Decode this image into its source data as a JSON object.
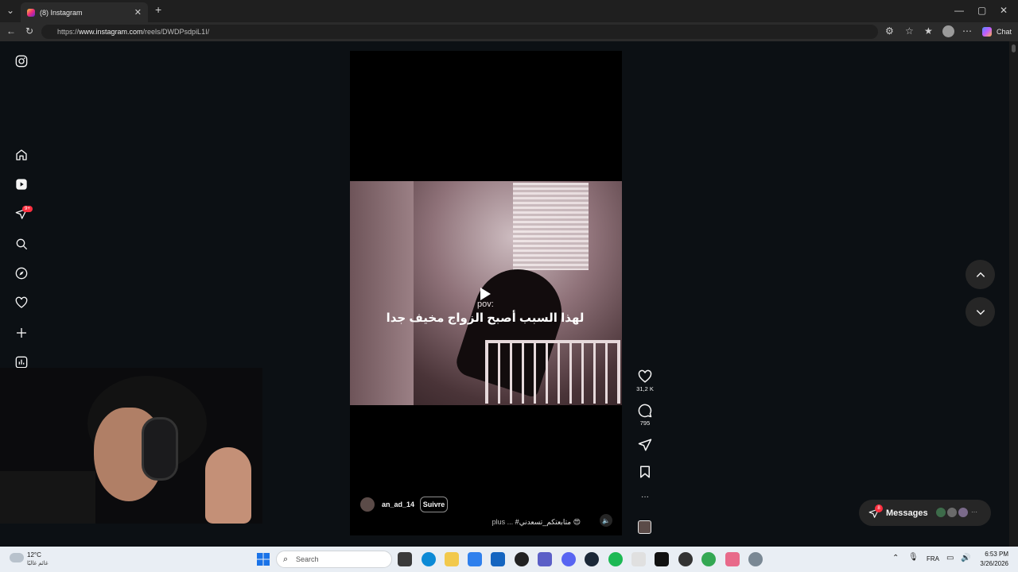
{
  "browser": {
    "tab_title": "(8) Instagram",
    "tab_close": "✕",
    "new_tab": "+",
    "url_prefix": "https://",
    "url_host": "www.instagram.com",
    "url_path": "/reels/DWDPsdpiL1I/",
    "chat_label": "Chat",
    "window_controls": [
      "—",
      "▢",
      "✕"
    ]
  },
  "sidebar": {
    "notification_badge": "9+",
    "icons": [
      "instagram-logo-icon",
      "home-icon",
      "reels-icon",
      "messages-icon",
      "search-icon",
      "explore-icon",
      "heart-icon",
      "create-icon",
      "dashboard-icon",
      "profile-icon",
      "menu-icon"
    ]
  },
  "reel": {
    "overlay_text_small": "pov:",
    "overlay_text_main": "لهذا السبب أصبح الزواج مخيف جدا",
    "username": "an_ad_14",
    "follow_label": "Suivre",
    "description": "#متابعتكم_تسعدني 😍",
    "more_label": "plus ...",
    "mute_icon": "🔈"
  },
  "actions": {
    "likes": "31,2 K",
    "comments": "795",
    "more": "···"
  },
  "messages": {
    "label": "Messages",
    "badge": "8",
    "more": "···"
  },
  "taskbar": {
    "temperature": "12°C",
    "weather_desc": "غائم غالبًا",
    "search_placeholder": "Search",
    "language": "FRA",
    "time": "6:53 PM",
    "date": "3/26/2026"
  },
  "colors": {
    "background": "#0c1014",
    "notification_red": "#ff3040",
    "taskbar": "#e9eef4"
  }
}
